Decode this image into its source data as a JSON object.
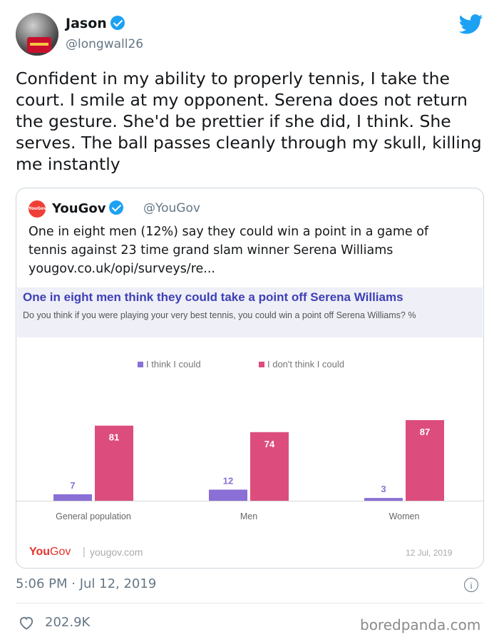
{
  "tweet": {
    "author_name": "Jason",
    "author_handle": "@longwall26",
    "text": "Confident in my ability to properly tennis, I take the court. I smile at my opponent. Serena does not return the gesture. She'd be prettier if she did, I think. She serves. The ball passes cleanly through my skull, killing me instantly",
    "timestamp": "5:06 PM · Jul 12, 2019",
    "likes": "202.9K",
    "icons": [
      "verified-badge-icon",
      "twitter-bird-icon",
      "info-icon",
      "heart-icon"
    ]
  },
  "quote": {
    "logo_text": "YouGov",
    "author_name": "YouGov",
    "author_handle": "@YouGov",
    "text": "One in eight men (12%) say they could win a point in a game of tennis against 23 time grand slam winner Serena Williams yougov.co.uk/opi/surveys/re..."
  },
  "card": {
    "footer_logo_you": "You",
    "footer_logo_gov": "Gov",
    "footer_url": "yougov.com",
    "footer_date": "12 Jul, 2019"
  },
  "chart_data": {
    "type": "bar",
    "title": "One in eight men think they could take a point off Serena Williams",
    "subtitle": "Do you think if you were playing your very best tennis, you could win a point off Serena Williams? %",
    "categories": [
      "General population",
      "Men",
      "Women"
    ],
    "series": [
      {
        "name": "I think I could",
        "values": [
          7,
          12,
          3
        ],
        "color": "#8a6fd6"
      },
      {
        "name": "I don't think I could",
        "values": [
          81,
          74,
          87
        ],
        "color": "#dc4d7e"
      }
    ],
    "legend": "top-center",
    "grid": false
  },
  "watermark": "boredpanda.com"
}
